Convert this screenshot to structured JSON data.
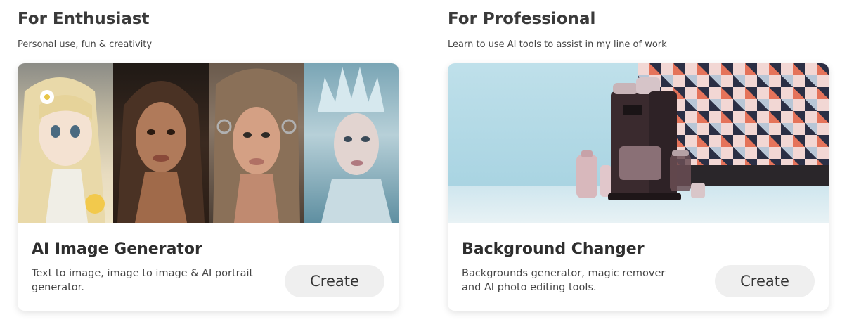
{
  "enthusiast": {
    "heading": "For Enthusiast",
    "subheading": "Personal use, fun & creativity",
    "card": {
      "title": "AI Image Generator",
      "description": "Text to image, image to image & AI portrait generator.",
      "button_label": "Create"
    }
  },
  "professional": {
    "heading": "For Professional",
    "subheading": "Learn to use AI tools to assist in my line of work",
    "card": {
      "title": "Background Changer",
      "description": "Backgrounds generator, magic remover and AI photo editing tools.",
      "button_label": "Create"
    }
  },
  "colors": {
    "button_bg": "#efefef",
    "heading_text": "#3a3a3a",
    "card_bg": "#ffffff"
  }
}
